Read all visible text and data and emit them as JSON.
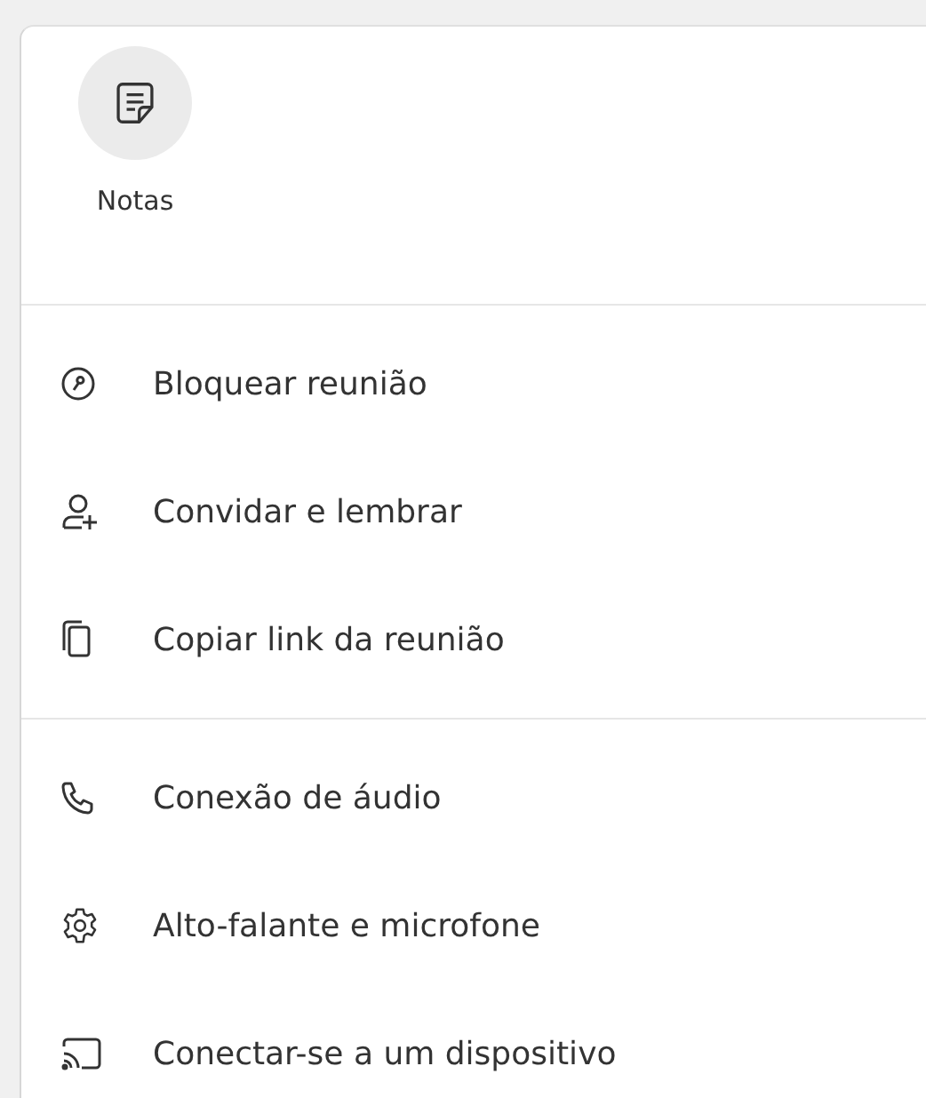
{
  "quick_actions": [
    {
      "label": "Notas",
      "kind": "notes"
    }
  ],
  "sections": [
    {
      "items": [
        {
          "label": "Bloquear reunião",
          "kind": "lock"
        },
        {
          "label": "Convidar e lembrar",
          "kind": "invite"
        },
        {
          "label": "Copiar link da reunião",
          "kind": "copy"
        }
      ]
    },
    {
      "items": [
        {
          "label": "Conexão de áudio",
          "kind": "audio"
        },
        {
          "label": "Alto-falante e microfone",
          "kind": "devices"
        },
        {
          "label": "Conectar-se a um dispositivo",
          "kind": "cast"
        }
      ]
    }
  ]
}
